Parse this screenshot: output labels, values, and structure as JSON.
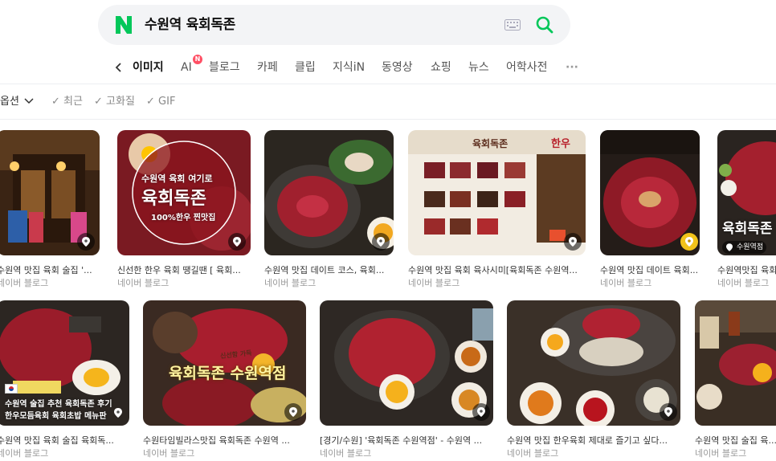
{
  "search": {
    "query": "수원역 육회독존"
  },
  "tabs": [
    {
      "label": "이미지",
      "active": true
    },
    {
      "label": "AI",
      "badge": "N"
    },
    {
      "label": "블로그"
    },
    {
      "label": "카페"
    },
    {
      "label": "클립"
    },
    {
      "label": "지식iN"
    },
    {
      "label": "동영상"
    },
    {
      "label": "쇼핑"
    },
    {
      "label": "뉴스"
    },
    {
      "label": "어학사전"
    },
    {
      "label": "···"
    }
  ],
  "filters": {
    "options_label": "옵션",
    "items": [
      "최근",
      "고화질",
      "GIF"
    ]
  },
  "results_row1": [
    {
      "title": "수원역 맛집 육회 술집 '...",
      "source": "네이버 블로그"
    },
    {
      "title": "신선한 한우 육회 땡길땐 [ 육회...",
      "source": "네이버 블로그",
      "overlay_line1": "수원역 육회 여기로",
      "overlay_line2": "육회독존",
      "overlay_line3": "100%한우 찐맛집"
    },
    {
      "title": "수원역 맛집 데이트 코스, 육회...",
      "source": "네이버 블로그"
    },
    {
      "title": "수원역 맛집 육회 육사시미[육회독존 수원역...",
      "source": "네이버 블로그",
      "overlay_line1": "육회독존",
      "overlay_line2": "한우"
    },
    {
      "title": "수원역 맛집 데이트 육회...",
      "source": "네이버 블로그"
    },
    {
      "title": "수원역맛집 육회...",
      "source": "네이버 블로그",
      "overlay_line1": "육회독존",
      "overlay_line2": "수원역점"
    }
  ],
  "results_row2": [
    {
      "title": "수원역 맛집 육회 술집 육회독...",
      "source": "네이버 블로그",
      "overlay_line1": "수원역 술집 추천 육회독존 후기",
      "overlay_line2": "한우모듬육회 육회초밥 메뉴판"
    },
    {
      "title": "수원타임빌라스맛집 육회독존 수원역 ...",
      "source": "네이버 블로그",
      "overlay_line1": "육회독존 수원역점",
      "overlay_line2": "신선함 가득"
    },
    {
      "title": "[경기/수원] '육회독존 수원역점' - 수원역 ...",
      "source": "네이버 블로그"
    },
    {
      "title": "수원역 맛집 한우육회 제대로 즐기고 싶다...",
      "source": "네이버 블로그"
    },
    {
      "title": "수원역 맛집 술집 육...",
      "source": "네이버 블로그"
    }
  ],
  "colors": {
    "naver_green": "#03c75a",
    "ai_badge": "#ff4f64",
    "location_pin_yellow": "#f2c31a"
  }
}
